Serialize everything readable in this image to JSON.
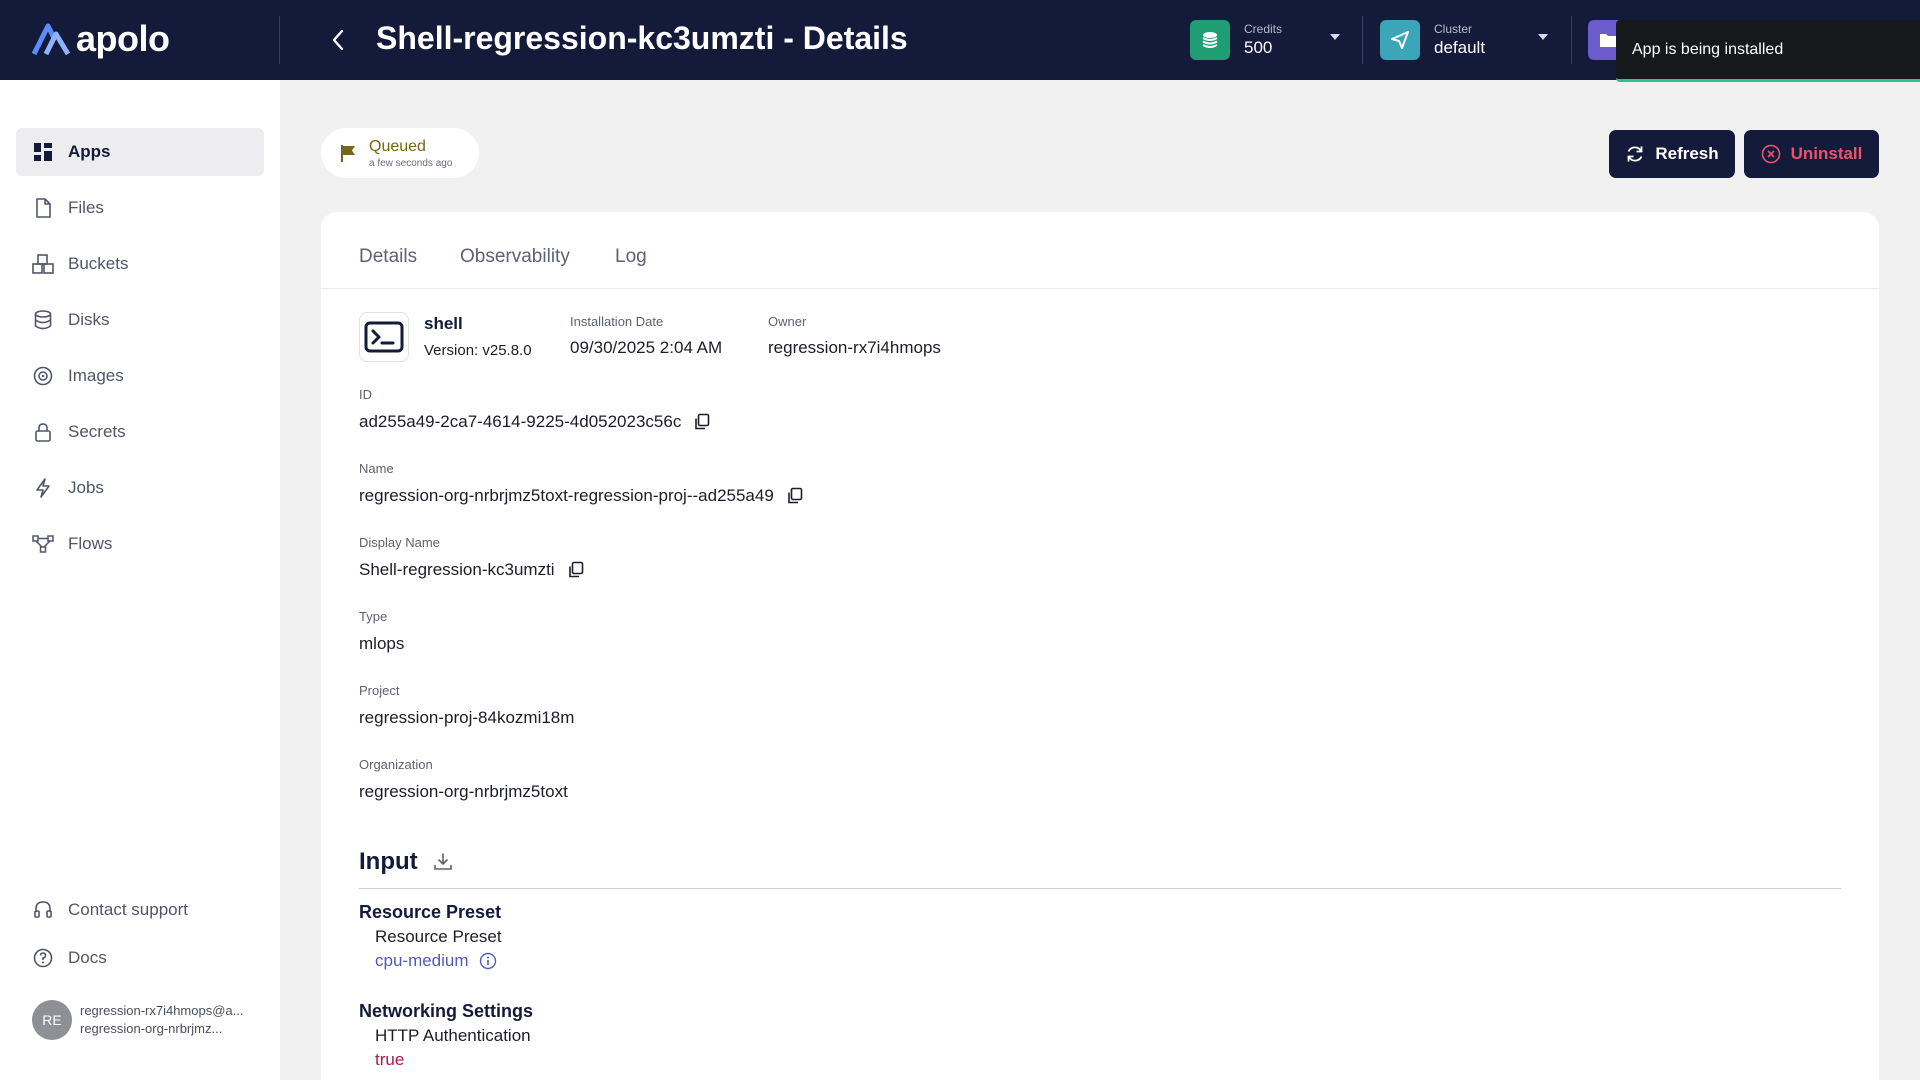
{
  "brand": {
    "name": "apolo"
  },
  "header": {
    "title": "Shell-regression-kc3umzti - Details",
    "credits": {
      "label": "Credits",
      "value": "500"
    },
    "cluster": {
      "label": "Cluster",
      "value": "default"
    }
  },
  "toast": {
    "message": "App is being installed"
  },
  "sidebar": {
    "items": [
      {
        "label": "Apps",
        "icon": "apps-grid-icon"
      },
      {
        "label": "Files",
        "icon": "file-icon"
      },
      {
        "label": "Buckets",
        "icon": "bucket-icon"
      },
      {
        "label": "Disks",
        "icon": "disk-icon"
      },
      {
        "label": "Images",
        "icon": "image-icon"
      },
      {
        "label": "Secrets",
        "icon": "lock-icon"
      },
      {
        "label": "Jobs",
        "icon": "bolt-icon"
      },
      {
        "label": "Flows",
        "icon": "flow-icon"
      }
    ],
    "footer": [
      {
        "label": "Contact support",
        "icon": "headset-icon"
      },
      {
        "label": "Docs",
        "icon": "help-icon"
      }
    ],
    "user": {
      "initials": "RE",
      "email": "regression-rx7i4hmops@a...",
      "org": "regression-org-nrbrjmz..."
    }
  },
  "status": {
    "label": "Queued",
    "time": "a few seconds ago"
  },
  "actions": {
    "refresh": "Refresh",
    "uninstall": "Uninstall"
  },
  "tabs": [
    "Details",
    "Observability",
    "Log"
  ],
  "app": {
    "name": "shell",
    "version": "Version: v25.8.0",
    "installation_date_label": "Installation Date",
    "installation_date": "09/30/2025 2:04 AM",
    "owner_label": "Owner",
    "owner": "regression-rx7i4hmops"
  },
  "fields": {
    "id": {
      "label": "ID",
      "value": "ad255a49-2ca7-4614-9225-4d052023c56c"
    },
    "name": {
      "label": "Name",
      "value": "regression-org-nrbrjmz5toxt-regression-proj--ad255a49"
    },
    "display_name": {
      "label": "Display Name",
      "value": "Shell-regression-kc3umzti"
    },
    "type": {
      "label": "Type",
      "value": "mlops"
    },
    "project": {
      "label": "Project",
      "value": "regression-proj-84kozmi18m"
    },
    "organization": {
      "label": "Organization",
      "value": "regression-org-nrbrjmz5toxt"
    }
  },
  "input": {
    "title": "Input",
    "resource_preset": {
      "group": "Resource Preset",
      "label": "Resource Preset",
      "value": "cpu-medium"
    },
    "networking": {
      "group": "Networking Settings",
      "label": "HTTP Authentication",
      "value": "true"
    }
  },
  "colors": {
    "header_bg": "#141a3a",
    "credits_icon": "#1f9d73",
    "cluster_icon": "#3aa6b8",
    "toast_accent": "#27c48f",
    "uninstall_text": "#f0526c"
  }
}
